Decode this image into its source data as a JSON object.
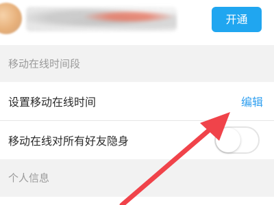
{
  "top": {
    "open_button_label": "开通"
  },
  "sections": {
    "mobile_online_period": "移动在线时间段",
    "personal_info": "个人信息"
  },
  "rows": {
    "set_mobile_online_time": "设置移动在线时间",
    "edit_label": "编辑",
    "hide_mobile_online_from_all_friends": "移动在线对所有好友隐身"
  },
  "toggle": {
    "hide_mobile_online_enabled": false
  },
  "colors": {
    "accent_blue": "#20a6f0",
    "link_blue": "#2f9ff0",
    "arrow_red": "#f0434a",
    "section_bg": "#f2f2f2"
  },
  "icons": {
    "annotation": "red-arrow-icon"
  }
}
